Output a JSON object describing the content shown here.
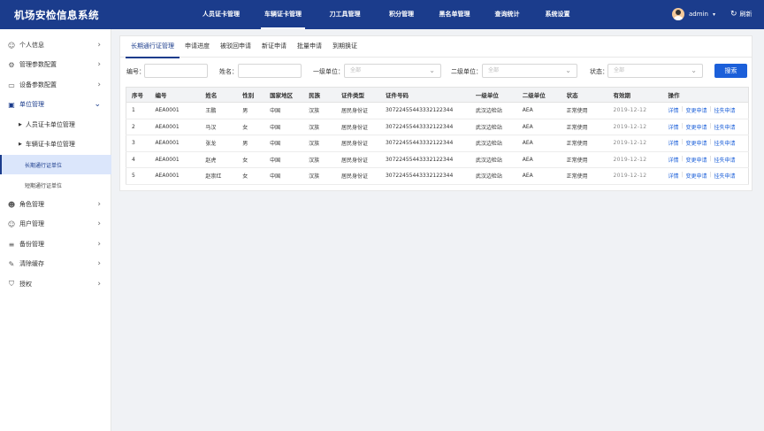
{
  "app": {
    "title": "机场安检信息系统"
  },
  "nav": [
    {
      "label": "人员证卡管理",
      "active": false
    },
    {
      "label": "车辆证卡管理",
      "active": true
    },
    {
      "label": "刀工具管理",
      "active": false
    },
    {
      "label": "积分管理",
      "active": false
    },
    {
      "label": "黑名单管理",
      "active": false
    },
    {
      "label": "查询统计",
      "active": false
    },
    {
      "label": "系统设置",
      "active": false
    }
  ],
  "user": {
    "name": "admin",
    "refresh_label": "刷新"
  },
  "sidebar": {
    "items": [
      {
        "label": "个人信息",
        "icon": "user-icon"
      },
      {
        "label": "管理参数配置",
        "icon": "settings-icon"
      },
      {
        "label": "设备参数配置",
        "icon": "device-icon"
      },
      {
        "label": "单位管理",
        "icon": "folder-icon"
      }
    ],
    "subs": [
      {
        "label": "人员证卡单位管理"
      },
      {
        "label": "车辆证卡单位管理"
      }
    ],
    "leaves": [
      {
        "label": "长期通行证单位",
        "active": true
      },
      {
        "label": "短期通行证单位",
        "active": false
      }
    ],
    "bottom_items": [
      {
        "label": "角色管理",
        "icon": "role-icon"
      },
      {
        "label": "用户管理",
        "icon": "users-icon"
      },
      {
        "label": "备份管理",
        "icon": "database-icon"
      },
      {
        "label": "清除缓存",
        "icon": "clear-icon"
      },
      {
        "label": "授权",
        "icon": "shield-icon"
      }
    ]
  },
  "tabs": [
    {
      "label": "长期通行证管理",
      "active": true
    },
    {
      "label": "申请进度",
      "active": false
    },
    {
      "label": "被驳回申请",
      "active": false
    },
    {
      "label": "新证申请",
      "active": false
    },
    {
      "label": "批量申请",
      "active": false
    },
    {
      "label": "到期换证",
      "active": false
    }
  ],
  "filters": {
    "code_label": "编号：",
    "name_label": "姓名：",
    "unit1_label": "一级单位：",
    "unit1_value": "全部",
    "unit2_label": "二级单位：",
    "unit2_value": "全部",
    "status_label": "状态：",
    "status_value": "全部",
    "search_label": "搜索"
  },
  "table": {
    "headers": [
      "序号",
      "编号",
      "姓名",
      "性别",
      "国家地区",
      "民族",
      "证件类型",
      "证件号码",
      "一级单位",
      "二级单位",
      "状态",
      "有效期",
      "操作"
    ],
    "rows": [
      [
        "1",
        "AEA0001",
        "王鹏",
        "男",
        "中国",
        "汉族",
        "居民身份证",
        "30722455443332122344",
        "武汉边检站",
        "AEA",
        "正常使用",
        "2019-12-12"
      ],
      [
        "2",
        "AEA0001",
        "马汉",
        "女",
        "中国",
        "汉族",
        "居民身份证",
        "30722455443332122344",
        "武汉边检站",
        "AEA",
        "正常使用",
        "2019-12-12"
      ],
      [
        "3",
        "AEA0001",
        "张龙",
        "男",
        "中国",
        "汉族",
        "居民身份证",
        "30722455443332122344",
        "武汉边检站",
        "AEA",
        "正常使用",
        "2019-12-12"
      ],
      [
        "4",
        "AEA0001",
        "赵虎",
        "女",
        "中国",
        "汉族",
        "居民身份证",
        "30722455443332122344",
        "武汉边检站",
        "AEA",
        "正常使用",
        "2019-12-12"
      ],
      [
        "5",
        "AEA0001",
        "赵崇红",
        "女",
        "中国",
        "汉族",
        "居民身份证",
        "30722455443332122344",
        "武汉边检站",
        "AEA",
        "正常使用",
        "2019-12-12"
      ]
    ],
    "ops": [
      "详情",
      "变更申请",
      "挂失申请"
    ]
  }
}
